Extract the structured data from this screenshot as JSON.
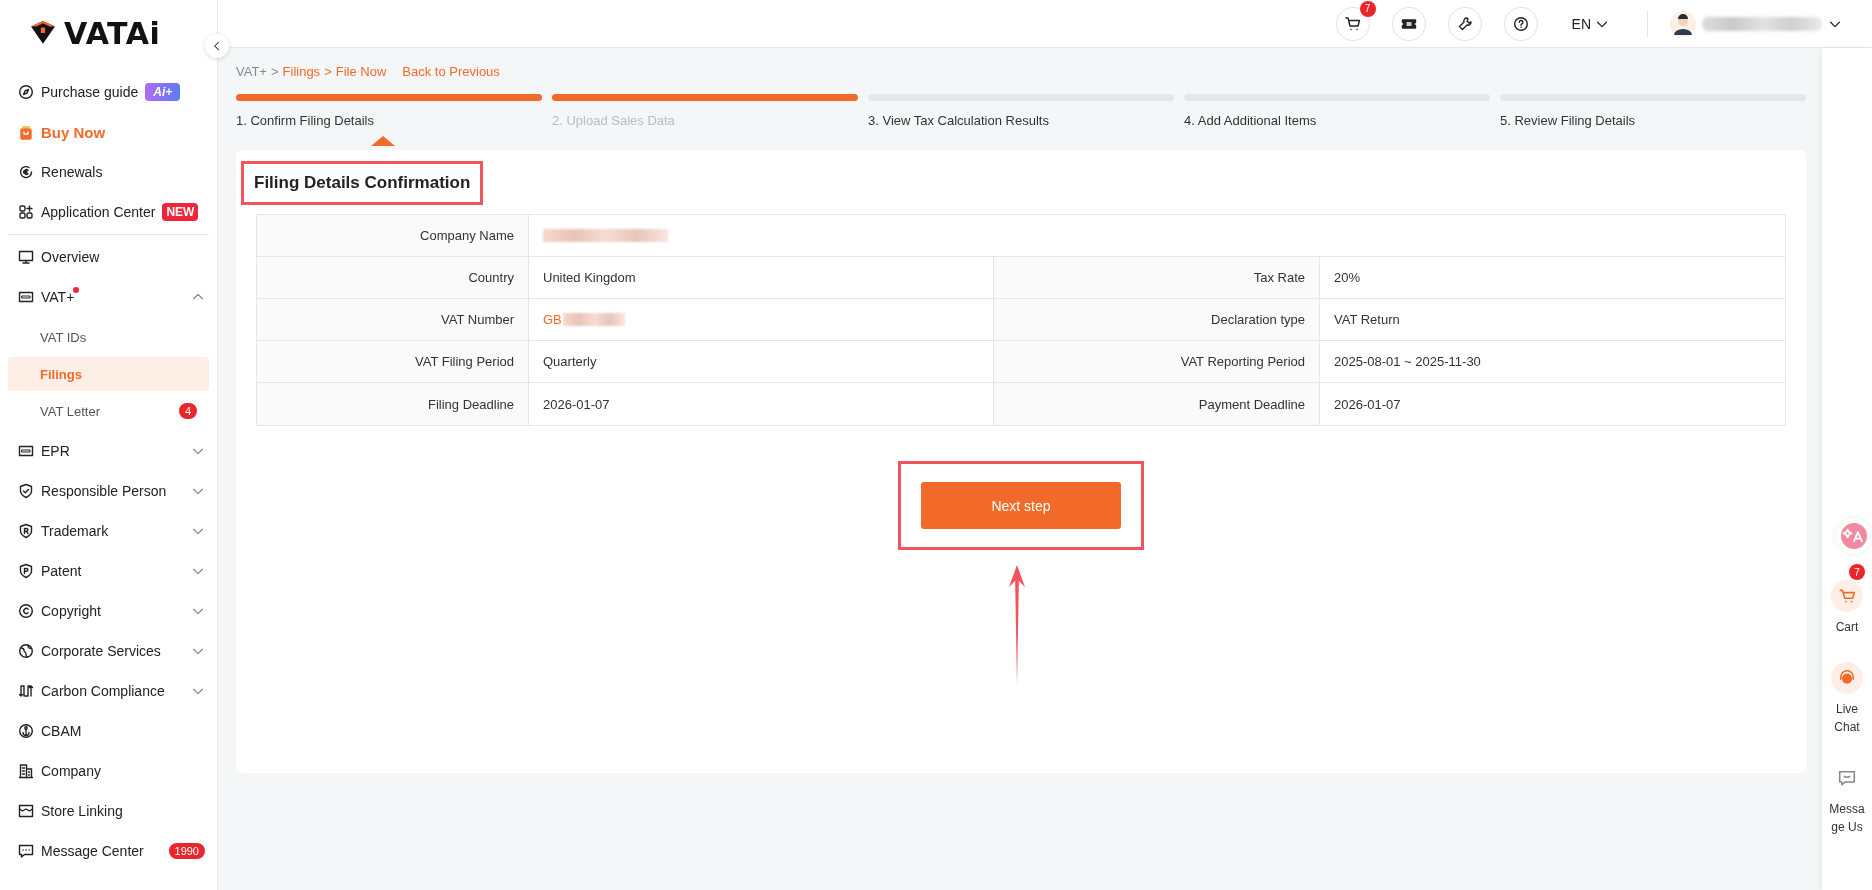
{
  "logo": {
    "text": "VATAi"
  },
  "sidebar": {
    "items": [
      {
        "label": "Purchase guide",
        "kind": "link",
        "tag": "Ai+"
      },
      {
        "label": "Buy Now",
        "kind": "promo"
      },
      {
        "label": "Renewals",
        "kind": "link"
      },
      {
        "label": "Application Center",
        "kind": "link",
        "badge": "NEW"
      },
      {
        "label": "Overview",
        "kind": "link"
      },
      {
        "label": "VAT+",
        "kind": "group",
        "expanded": true,
        "dot": true,
        "children": [
          {
            "label": "VAT IDs",
            "selected": false
          },
          {
            "label": "Filings",
            "selected": true
          },
          {
            "label": "VAT Letter",
            "selected": false,
            "count": "4"
          }
        ]
      },
      {
        "label": "EPR",
        "kind": "group",
        "expanded": false
      },
      {
        "label": "Responsible Person",
        "kind": "group",
        "expanded": false
      },
      {
        "label": "Trademark",
        "kind": "group",
        "expanded": false
      },
      {
        "label": "Patent",
        "kind": "group",
        "expanded": false
      },
      {
        "label": "Copyright",
        "kind": "group",
        "expanded": false
      },
      {
        "label": "Corporate Services",
        "kind": "group",
        "expanded": false
      },
      {
        "label": "Carbon Compliance",
        "kind": "group",
        "expanded": false
      },
      {
        "label": "CBAM",
        "kind": "link"
      },
      {
        "label": "Company",
        "kind": "link"
      },
      {
        "label": "Store Linking",
        "kind": "link"
      },
      {
        "label": "Message Center",
        "kind": "link",
        "count": "1990"
      }
    ]
  },
  "topbar": {
    "cart_count": "7",
    "language": "EN"
  },
  "breadcrumb": {
    "items": [
      {
        "text": "VAT+",
        "kind": "trail"
      },
      {
        "text": ">",
        "kind": "trail"
      },
      {
        "text": "Filings",
        "kind": "link"
      },
      {
        "text": ">",
        "kind": "link"
      },
      {
        "text": "File Now",
        "kind": "link"
      }
    ],
    "back_link": "Back to Previous"
  },
  "steps": [
    {
      "label": "1. Confirm Filing Details",
      "complete": true,
      "selected": true,
      "disabled": false
    },
    {
      "label": "2. Upload Sales Data",
      "complete": true,
      "selected": false,
      "disabled": true
    },
    {
      "label": "3. View Tax Calculation Results",
      "complete": false,
      "selected": false,
      "disabled": false
    },
    {
      "label": "4. Add Additional Items",
      "complete": false,
      "selected": false,
      "disabled": false
    },
    {
      "label": "5. Review Filing Details",
      "complete": false,
      "selected": false,
      "disabled": false
    }
  ],
  "card": {
    "title": "Filing Details Confirmation",
    "highlighted": true,
    "rows": [
      [
        {
          "label": "Company Name",
          "redacted": true
        }
      ],
      [
        {
          "label": "Country",
          "value": "United Kingdom"
        },
        {
          "label": "Tax Rate",
          "value": "20%"
        }
      ],
      [
        {
          "label": "VAT Number",
          "value": "GB",
          "link": true,
          "redacted": true
        },
        {
          "label": "Declaration type",
          "value": "VAT Return"
        }
      ],
      [
        {
          "label": "VAT Filing Period",
          "value": "Quarterly"
        },
        {
          "label": "VAT Reporting Period",
          "value": "2025-08-01 ~ 2025-11-30"
        }
      ],
      [
        {
          "label": "Filing Deadline",
          "value": "2026-01-07"
        },
        {
          "label": "Payment Deadline",
          "value": "2026-01-07"
        }
      ]
    ],
    "next_button": {
      "label": "Next step",
      "highlighted": true,
      "arrow": true
    }
  },
  "rail": {
    "cart_count": "7",
    "items": [
      {
        "label": "Cart"
      },
      {
        "label": "Live Chat"
      },
      {
        "label": "Message Us"
      }
    ]
  }
}
